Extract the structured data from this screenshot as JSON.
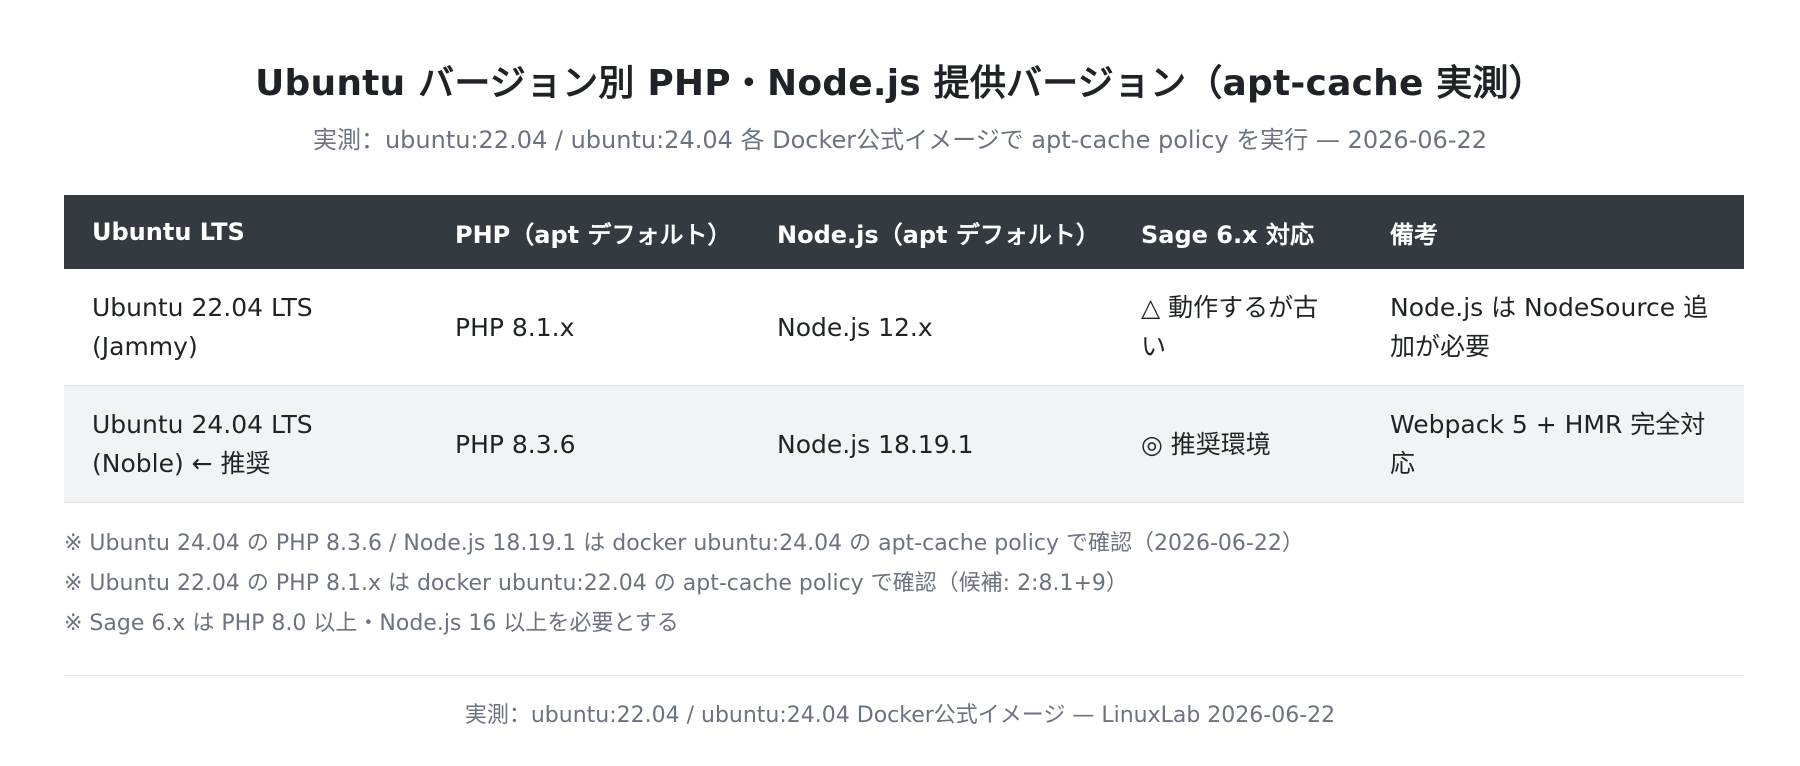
{
  "title": "Ubuntu バージョン別 PHP・Node.js 提供バージョン（apt-cache 実測）",
  "subtitle": "実測：ubuntu:22.04 / ubuntu:24.04 各 Docker公式イメージで apt-cache policy を実行 — 2026-06-22",
  "table": {
    "headers": [
      "Ubuntu LTS",
      "PHP（apt デフォルト）",
      "Node.js（apt デフォルト）",
      "Sage 6.x 対応",
      "備考"
    ],
    "rows": [
      [
        "Ubuntu 22.04 LTS (Jammy)",
        "PHP 8.1.x",
        "Node.js 12.x",
        "△ 動作するが古い",
        "Node.js は NodeSource 追加が必要"
      ],
      [
        "Ubuntu 24.04 LTS (Noble) ← 推奨",
        "PHP 8.3.6",
        "Node.js 18.19.1",
        "◎ 推奨環境",
        "Webpack 5 + HMR 完全対応"
      ]
    ]
  },
  "notes": [
    "※ Ubuntu 24.04 の PHP 8.3.6 / Node.js 18.19.1 は docker ubuntu:24.04 の apt-cache policy で確認（2026-06-22）",
    "※ Ubuntu 22.04 の PHP 8.1.x は docker ubuntu:22.04 の apt-cache policy で確認（候補: 2:8.1+9）",
    "※ Sage 6.x は PHP 8.0 以上・Node.js 16 以上を必要とする"
  ],
  "footer": "実測：ubuntu:22.04 / ubuntu:24.04 Docker公式イメージ — LinuxLab 2026-06-22"
}
